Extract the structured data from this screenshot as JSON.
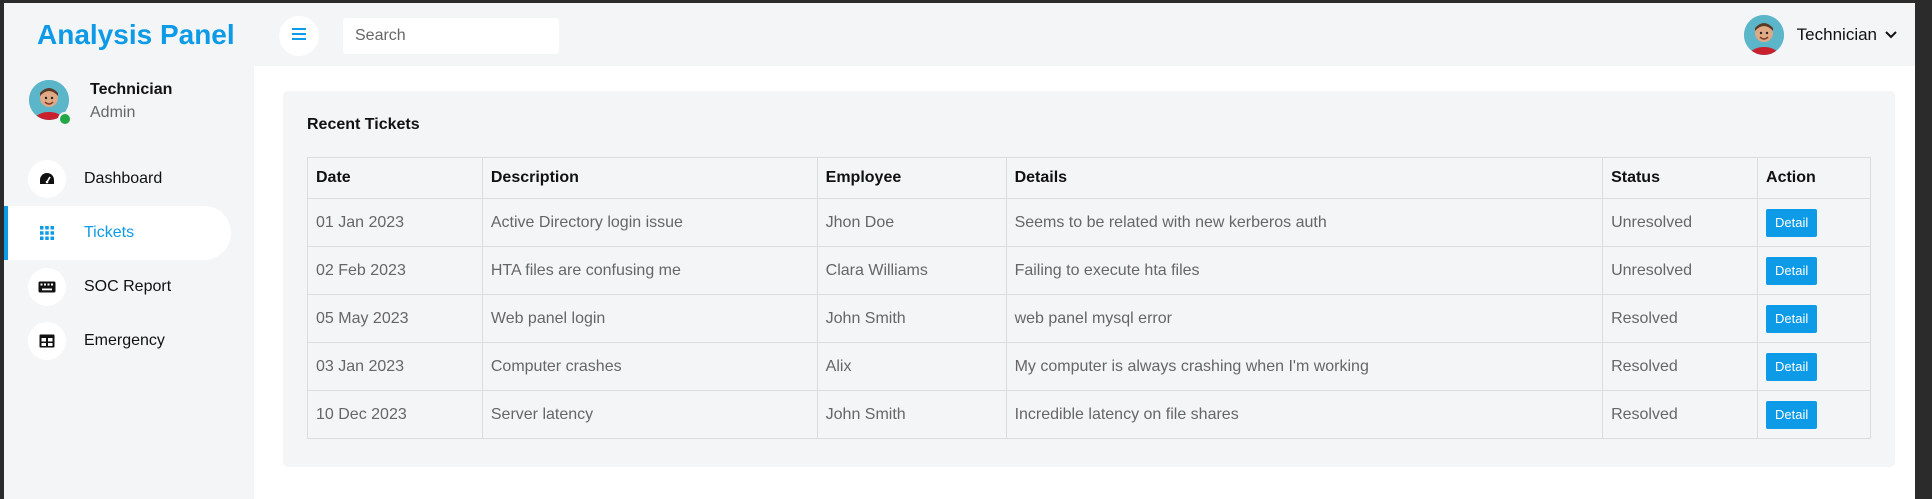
{
  "app": {
    "brand": "Analysis Panel"
  },
  "header": {
    "search_placeholder": "Search",
    "user_name": "Technician"
  },
  "sidebar": {
    "profile": {
      "name": "Technician",
      "role": "Admin"
    },
    "items": [
      {
        "label": "Dashboard",
        "icon": "speedometer-icon",
        "active": false
      },
      {
        "label": "Tickets",
        "icon": "grid-icon",
        "active": true
      },
      {
        "label": "SOC Report",
        "icon": "keyboard-icon",
        "active": false
      },
      {
        "label": "Emergency",
        "icon": "table-icon",
        "active": false
      }
    ]
  },
  "tickets": {
    "title": "Recent Tickets",
    "columns": [
      "Date",
      "Description",
      "Employee",
      "Details",
      "Status",
      "Action"
    ],
    "rows": [
      {
        "date": "01 Jan 2023",
        "description": "Active Directory login issue",
        "employee": "Jhon Doe",
        "details": "Seems to be related with new kerberos auth",
        "status": "Unresolved",
        "action": "Detail"
      },
      {
        "date": "02 Feb 2023",
        "description": "HTA files are confusing me",
        "employee": "Clara Williams",
        "details": "Failing to execute hta files",
        "status": "Unresolved",
        "action": "Detail"
      },
      {
        "date": "05 May 2023",
        "description": "Web panel login",
        "employee": "John Smith",
        "details": "web panel mysql error",
        "status": "Resolved",
        "action": "Detail"
      },
      {
        "date": "03 Jan 2023",
        "description": "Computer crashes",
        "employee": "Alix",
        "details": "My computer is always crashing when I'm working",
        "status": "Resolved",
        "action": "Detail"
      },
      {
        "date": "10 Dec 2023",
        "description": "Server latency",
        "employee": "John Smith",
        "details": "Incredible latency on file shares",
        "status": "Resolved",
        "action": "Detail"
      }
    ]
  },
  "colors": {
    "accent": "#0d9ae6",
    "panel_bg": "#f3f5f7",
    "online": "#22a745"
  }
}
